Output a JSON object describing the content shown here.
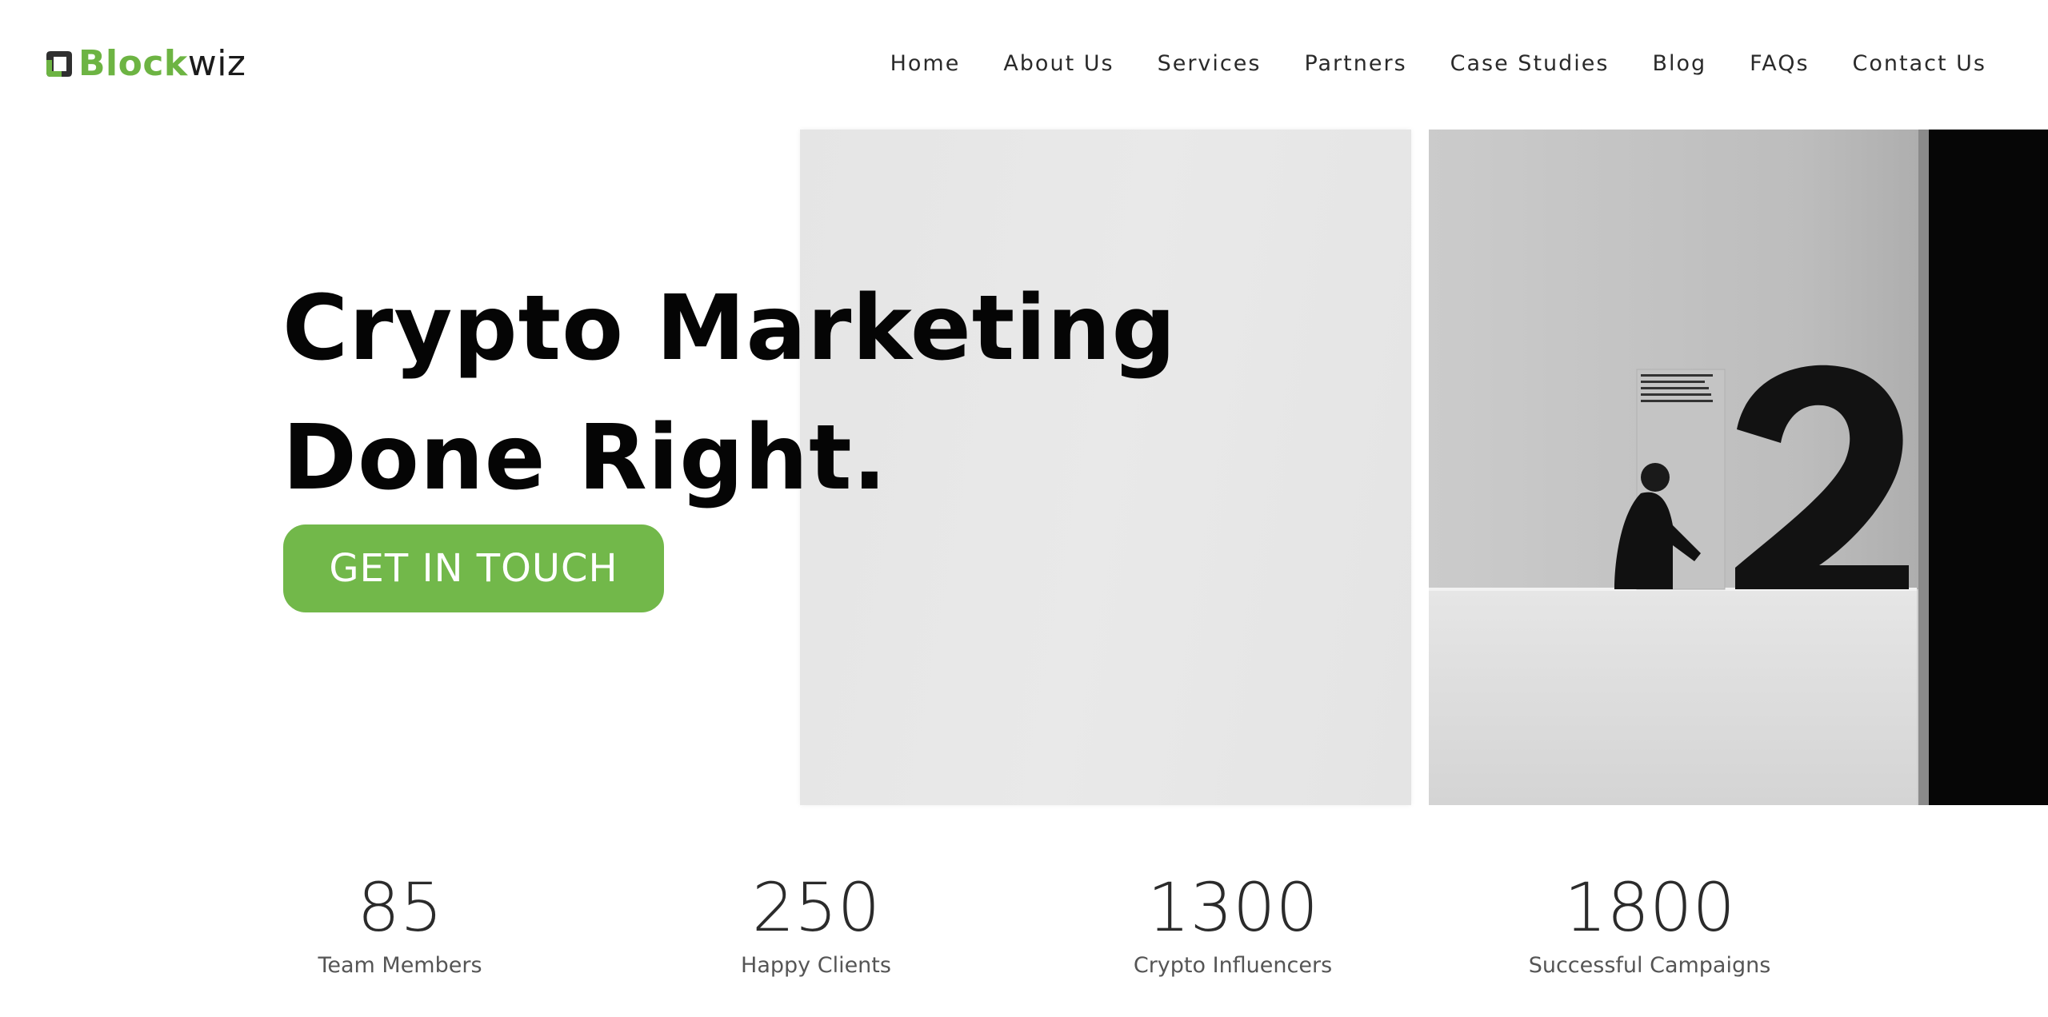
{
  "logo": {
    "brand": "Block",
    "suffix": "wiz",
    "icon": "blockwiz-logo-icon",
    "brand_color": "#6db443"
  },
  "nav": {
    "items": [
      {
        "label": "Home"
      },
      {
        "label": "About Us"
      },
      {
        "label": "Services"
      },
      {
        "label": "Partners"
      },
      {
        "label": "Case Studies"
      },
      {
        "label": "Blog"
      },
      {
        "label": "FAQs"
      },
      {
        "label": "Contact Us"
      }
    ]
  },
  "hero": {
    "title_line1": "Crypto Marketing",
    "title_line2": "Done Right.",
    "cta_label": "GET IN TOUCH",
    "cta_color": "#72b84a",
    "photo_subject": "person walking past large number 2 on gallery wall"
  },
  "stats": [
    {
      "value": "85",
      "label": "Team Members"
    },
    {
      "value": "250",
      "label": "Happy Clients"
    },
    {
      "value": "1300",
      "label": "Crypto Influencers"
    },
    {
      "value": "1800",
      "label": "Successful Campaigns"
    }
  ]
}
